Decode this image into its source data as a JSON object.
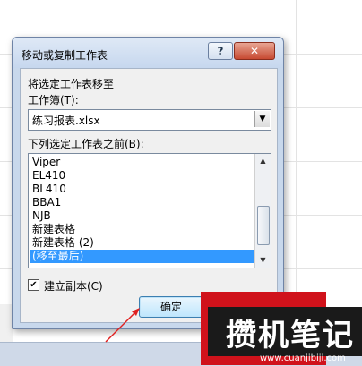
{
  "dialog": {
    "title": "移动或复制工作表",
    "help_glyph": "?",
    "close_glyph": "✕",
    "move_to_label": "将选定工作表移至",
    "workbook_label": "工作簿(T):",
    "workbook_value": "练习报表.xlsx",
    "before_sheet_label": "下列选定工作表之前(B):",
    "sheets": [
      "Viper",
      "EL410",
      "BL410",
      "BBA1",
      "NJB",
      "新建表格",
      "新建表格 (2)",
      "(移至最后)"
    ],
    "selected_sheet": "(移至最后)",
    "create_copy_label": "建立副本(C)",
    "create_copy_checked": true,
    "ok_button": "确定"
  },
  "watermark": {
    "text": "攒机笔记",
    "url": "www.cuanjibiji.com"
  },
  "colors": {
    "selection": "#3399ff",
    "watermark_red": "#d0121b",
    "arrow_red": "#e02020"
  }
}
